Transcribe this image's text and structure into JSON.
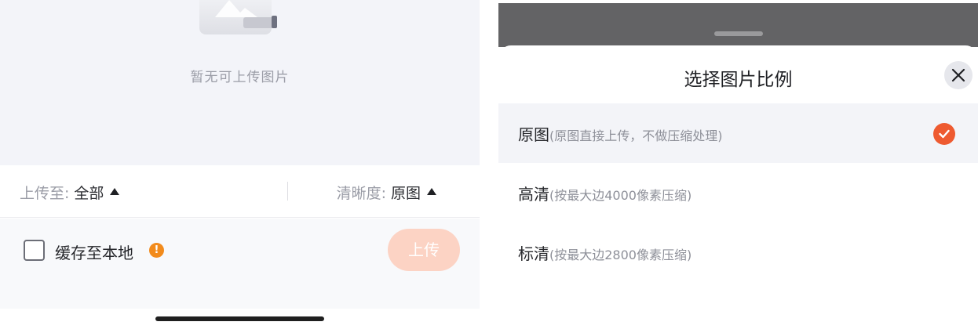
{
  "left_panel": {
    "empty_text": "暂无可上传图片",
    "filter": {
      "upload_to_label": "上传至:",
      "upload_to_value": "全部",
      "quality_label": "清晰度:",
      "quality_value": "原图"
    },
    "cache_label": "缓存至本地",
    "warn_symbol": "!",
    "upload_button": "上传",
    "colors": {
      "accent_disabled": "#fcd3c4",
      "warning": "#f28b1c"
    }
  },
  "sheet": {
    "title": "选择图片比例",
    "options": [
      {
        "label": "原图",
        "desc": "(原图直接上传，不做压缩处理)",
        "selected": true
      },
      {
        "label": "高清",
        "desc": "(按最大边4000像素压缩)",
        "selected": false
      },
      {
        "label": "标清",
        "desc": "(按最大边2800像素压缩)",
        "selected": false
      }
    ],
    "colors": {
      "check": "#ee5a30"
    }
  }
}
